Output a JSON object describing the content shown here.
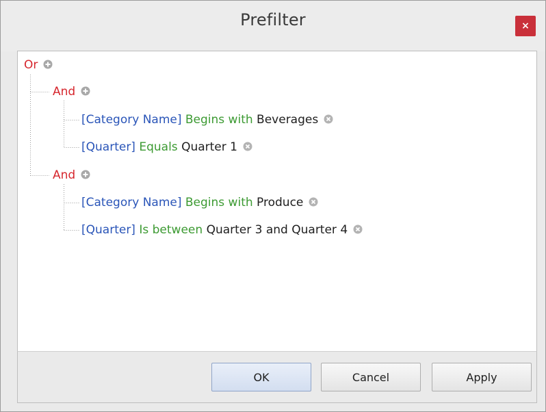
{
  "window": {
    "title": "Prefilter",
    "close_label": "×"
  },
  "filter_tree": {
    "root": {
      "operator": "Or"
    },
    "groups": [
      {
        "operator": "And",
        "conditions": [
          {
            "field": "[Category Name]",
            "op": "Begins with",
            "value": "Beverages"
          },
          {
            "field": "[Quarter]",
            "op": "Equals",
            "value": "Quarter 1"
          }
        ]
      },
      {
        "operator": "And",
        "conditions": [
          {
            "field": "[Category Name]",
            "op": "Begins with",
            "value": "Produce"
          },
          {
            "field": "[Quarter]",
            "op": "Is between",
            "value": "Quarter 3 and Quarter 4"
          }
        ]
      }
    ]
  },
  "buttons": {
    "ok": "OK",
    "cancel": "Cancel",
    "apply": "Apply"
  },
  "colors": {
    "operator": "#d6262d",
    "field": "#2a55b8",
    "condition_op": "#3c9a32",
    "value": "#1e1e1e",
    "close_button": "#c9303a"
  }
}
